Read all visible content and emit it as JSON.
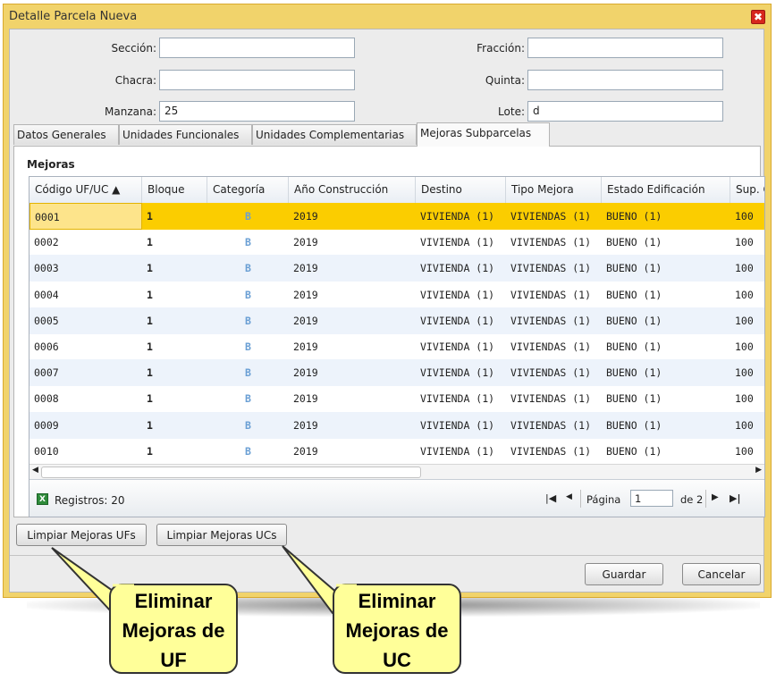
{
  "window": {
    "title": "Detalle Parcela Nueva",
    "close_glyph": "✖"
  },
  "fields": {
    "seccion": {
      "label": "Sección:",
      "value": ""
    },
    "chacra": {
      "label": "Chacra:",
      "value": ""
    },
    "manzana": {
      "label": "Manzana:",
      "value": "25"
    },
    "fraccion": {
      "label": "Fracción:",
      "value": ""
    },
    "quinta": {
      "label": "Quinta:",
      "value": ""
    },
    "lote": {
      "label": "Lote:",
      "value": "d"
    }
  },
  "tabs": [
    "Datos Generales",
    "Unidades Funcionales",
    "Unidades Complementarias",
    "Mejoras Subparcelas"
  ],
  "active_tab": "Mejoras Subparcelas",
  "panel_title": "Mejoras",
  "grid": {
    "columns": [
      "Código UF/UC ▲",
      "Bloque",
      "Categoría",
      "Año Construcción",
      "Destino",
      "Tipo Mejora",
      "Estado Edificación",
      "Sup. C"
    ],
    "rows": [
      [
        "0001",
        "1",
        "B",
        "2019",
        "VIVIENDA (1)",
        "VIVIENDAS (1)",
        "BUENO (1)",
        "100"
      ],
      [
        "0002",
        "1",
        "B",
        "2019",
        "VIVIENDA (1)",
        "VIVIENDAS (1)",
        "BUENO (1)",
        "100"
      ],
      [
        "0003",
        "1",
        "B",
        "2019",
        "VIVIENDA (1)",
        "VIVIENDAS (1)",
        "BUENO (1)",
        "100"
      ],
      [
        "0004",
        "1",
        "B",
        "2019",
        "VIVIENDA (1)",
        "VIVIENDAS (1)",
        "BUENO (1)",
        "100"
      ],
      [
        "0005",
        "1",
        "B",
        "2019",
        "VIVIENDA (1)",
        "VIVIENDAS (1)",
        "BUENO (1)",
        "100"
      ],
      [
        "0006",
        "1",
        "B",
        "2019",
        "VIVIENDA (1)",
        "VIVIENDAS (1)",
        "BUENO (1)",
        "100"
      ],
      [
        "0007",
        "1",
        "B",
        "2019",
        "VIVIENDA (1)",
        "VIVIENDAS (1)",
        "BUENO (1)",
        "100"
      ],
      [
        "0008",
        "1",
        "B",
        "2019",
        "VIVIENDA (1)",
        "VIVIENDAS (1)",
        "BUENO (1)",
        "100"
      ],
      [
        "0009",
        "1",
        "B",
        "2019",
        "VIVIENDA (1)",
        "VIVIENDAS (1)",
        "BUENO (1)",
        "100"
      ],
      [
        "0010",
        "1",
        "B",
        "2019",
        "VIVIENDA (1)",
        "VIVIENDAS (1)",
        "BUENO (1)",
        "100"
      ]
    ],
    "selected_row": 0,
    "record_count": "Registros: 20",
    "page_label": "Página",
    "page_value": "1",
    "page_of": "de 2"
  },
  "buttons": {
    "limpiar_ufs": "Limpiar Mejoras UFs",
    "limpiar_ucs": "Limpiar Mejoras UCs",
    "guardar": "Guardar",
    "cancelar": "Cancelar"
  },
  "callouts": {
    "uf": [
      "Eliminar",
      "Mejoras de",
      "UF"
    ],
    "uc": [
      "Eliminar",
      "Mejoras de",
      "UC"
    ]
  },
  "colors": {
    "window_border": "#f1d36b",
    "selected_row": "#fbcd00",
    "callout_fill": "#ffff99"
  },
  "icons": {
    "excel": "excel-icon",
    "sort": "sort-asc-icon"
  }
}
